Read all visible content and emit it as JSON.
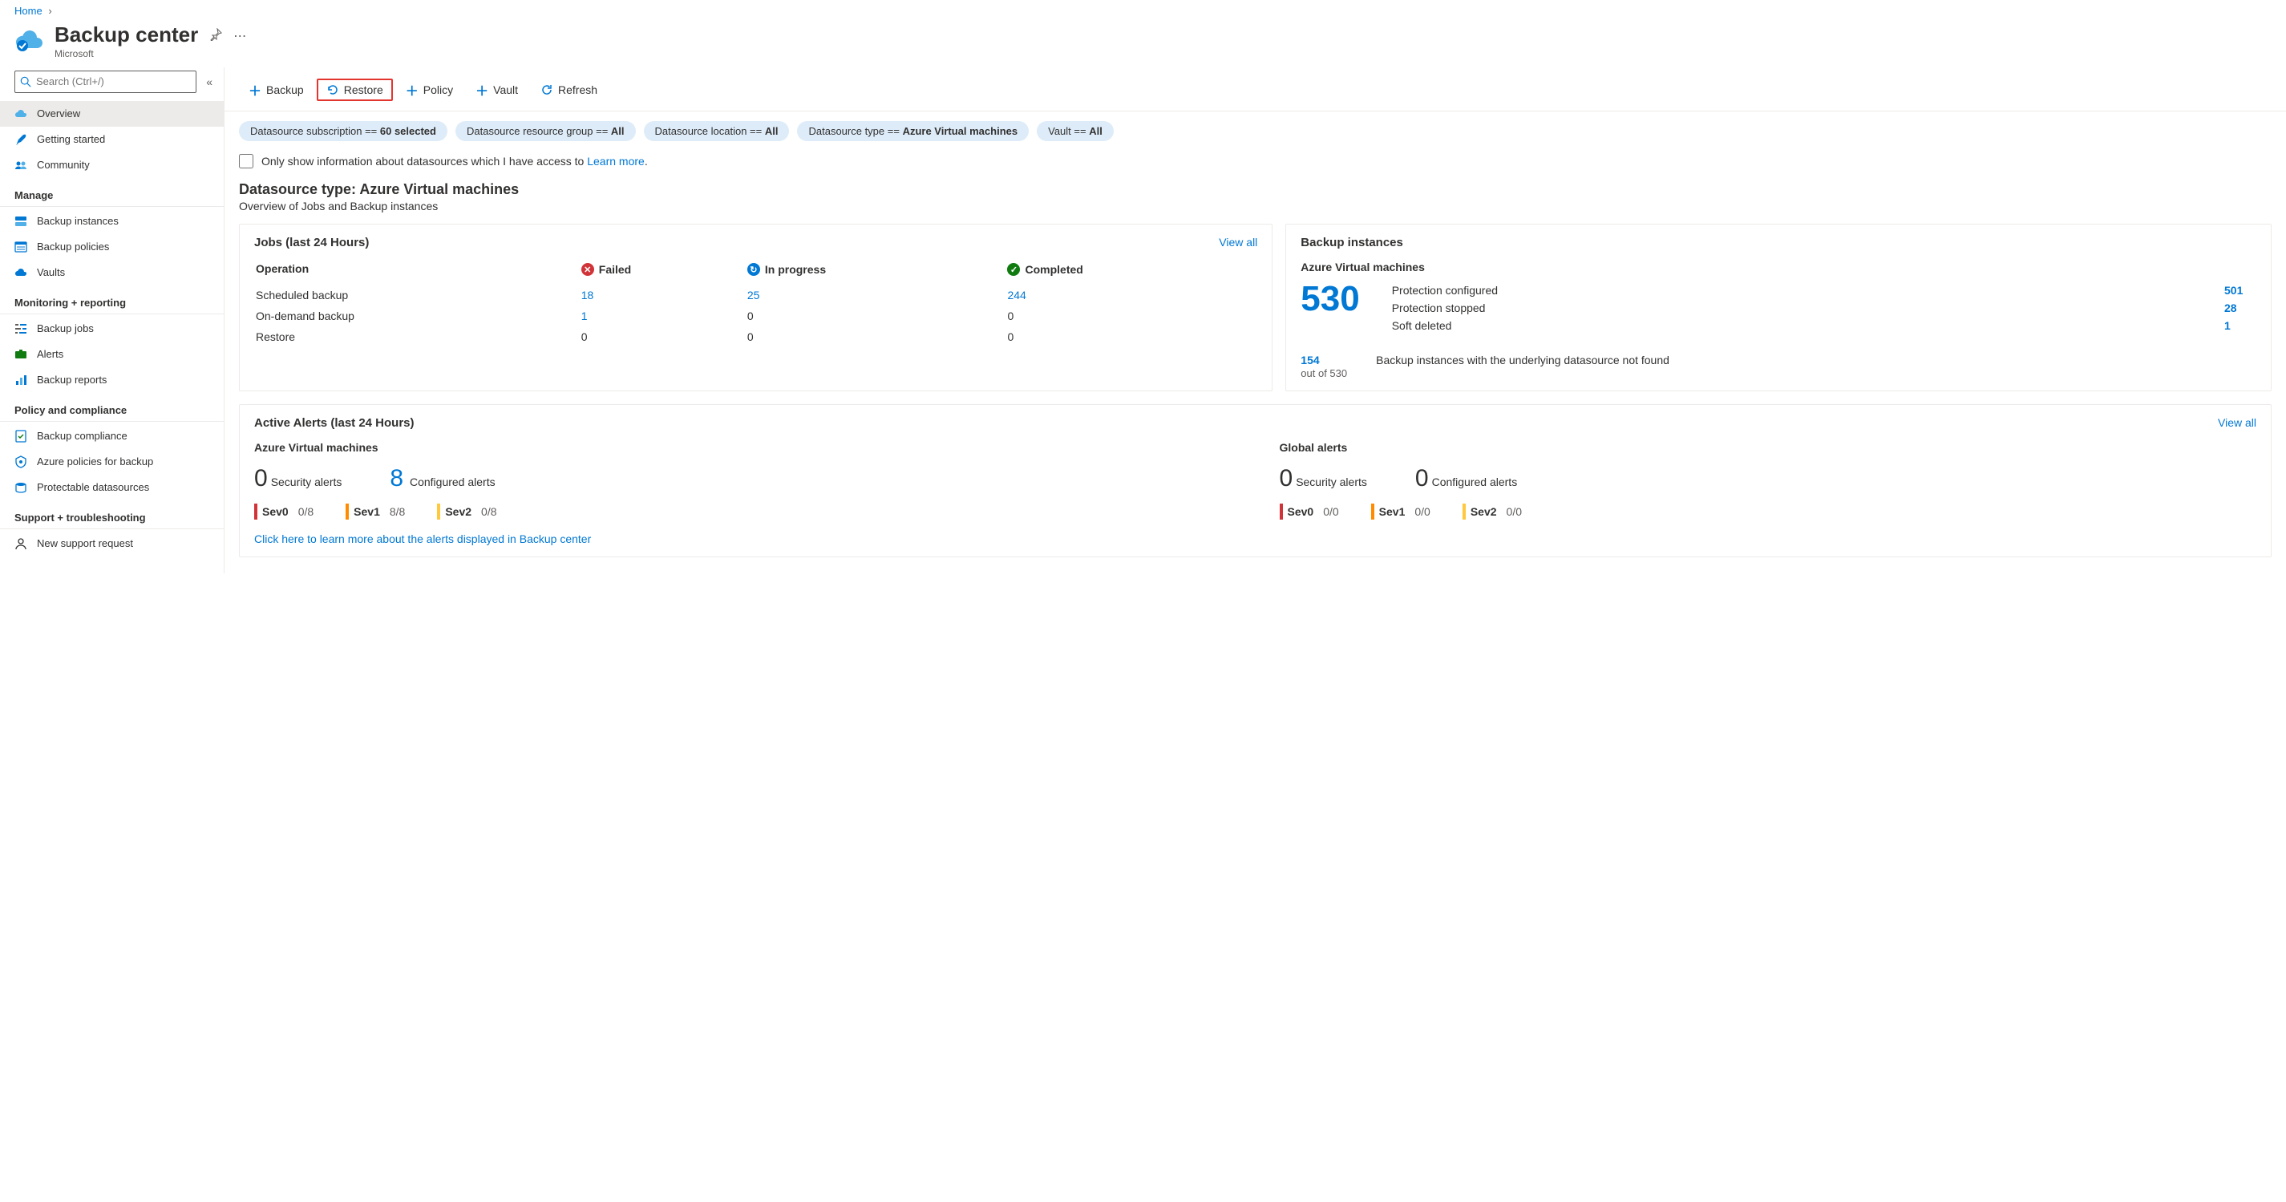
{
  "breadcrumb": {
    "home": "Home"
  },
  "header": {
    "title": "Backup center",
    "subtitle": "Microsoft"
  },
  "search": {
    "placeholder": "Search (Ctrl+/)"
  },
  "nav": {
    "top": [
      {
        "label": "Overview"
      },
      {
        "label": "Getting started"
      },
      {
        "label": "Community"
      }
    ],
    "manage_header": "Manage",
    "manage": [
      {
        "label": "Backup instances"
      },
      {
        "label": "Backup policies"
      },
      {
        "label": "Vaults"
      }
    ],
    "monitor_header": "Monitoring + reporting",
    "monitor": [
      {
        "label": "Backup jobs"
      },
      {
        "label": "Alerts"
      },
      {
        "label": "Backup reports"
      }
    ],
    "policy_header": "Policy and compliance",
    "policy": [
      {
        "label": "Backup compliance"
      },
      {
        "label": "Azure policies for backup"
      },
      {
        "label": "Protectable datasources"
      }
    ],
    "support_header": "Support + troubleshooting",
    "support": [
      {
        "label": "New support request"
      }
    ]
  },
  "toolbar": {
    "backup": "Backup",
    "restore": "Restore",
    "policy": "Policy",
    "vault": "Vault",
    "refresh": "Refresh"
  },
  "filters": {
    "sub_label": "Datasource subscription == ",
    "sub_val": "60 selected",
    "rg_label": "Datasource resource group == ",
    "rg_val": "All",
    "loc_label": "Datasource location == ",
    "loc_val": "All",
    "type_label": "Datasource type == ",
    "type_val": "Azure Virtual machines",
    "vault_label": "Vault == ",
    "vault_val": "All"
  },
  "checkbox": {
    "text": "Only show information about datasources which I have access to ",
    "link": "Learn more"
  },
  "section": {
    "title": "Datasource type: Azure Virtual machines",
    "sub": "Overview of Jobs and Backup instances"
  },
  "jobs": {
    "title": "Jobs (last 24 Hours)",
    "view_all": "View all",
    "h_op": "Operation",
    "h_failed": "Failed",
    "h_inprog": "In progress",
    "h_comp": "Completed",
    "rows": [
      {
        "op": "Scheduled backup",
        "failed": "18",
        "inprog": "25",
        "comp": "244",
        "link": true
      },
      {
        "op": "On-demand backup",
        "failed": "1",
        "inprog": "0",
        "comp": "0",
        "link": true
      },
      {
        "op": "Restore",
        "failed": "0",
        "inprog": "0",
        "comp": "0",
        "link": false
      }
    ]
  },
  "bi": {
    "title": "Backup instances",
    "sub": "Azure Virtual machines",
    "big": "530",
    "rows": [
      {
        "label": "Protection configured",
        "val": "501"
      },
      {
        "label": "Protection stopped",
        "val": "28"
      },
      {
        "label": "Soft deleted",
        "val": "1"
      }
    ],
    "foot_num": "154",
    "foot_of": "out of 530",
    "foot_text": "Backup instances with the underlying datasource not found"
  },
  "alerts": {
    "title": "Active Alerts (last 24 Hours)",
    "view_all": "View all",
    "avm": {
      "heading": "Azure Virtual machines",
      "sec_n": "0",
      "sec_l": "Security alerts",
      "cfg_n": "8",
      "cfg_l": "Configured alerts",
      "sev0": {
        "label": "Sev0",
        "ratio": "0/8"
      },
      "sev1": {
        "label": "Sev1",
        "ratio": "8/8",
        "link": true
      },
      "sev2": {
        "label": "Sev2",
        "ratio": "0/8"
      }
    },
    "global": {
      "heading": "Global alerts",
      "sec_n": "0",
      "sec_l": "Security alerts",
      "cfg_n": "0",
      "cfg_l": "Configured alerts",
      "sev0": {
        "label": "Sev0",
        "ratio": "0/0"
      },
      "sev1": {
        "label": "Sev1",
        "ratio": "0/0"
      },
      "sev2": {
        "label": "Sev2",
        "ratio": "0/0"
      }
    },
    "link": "Click here to learn more about the alerts displayed in Backup center"
  }
}
